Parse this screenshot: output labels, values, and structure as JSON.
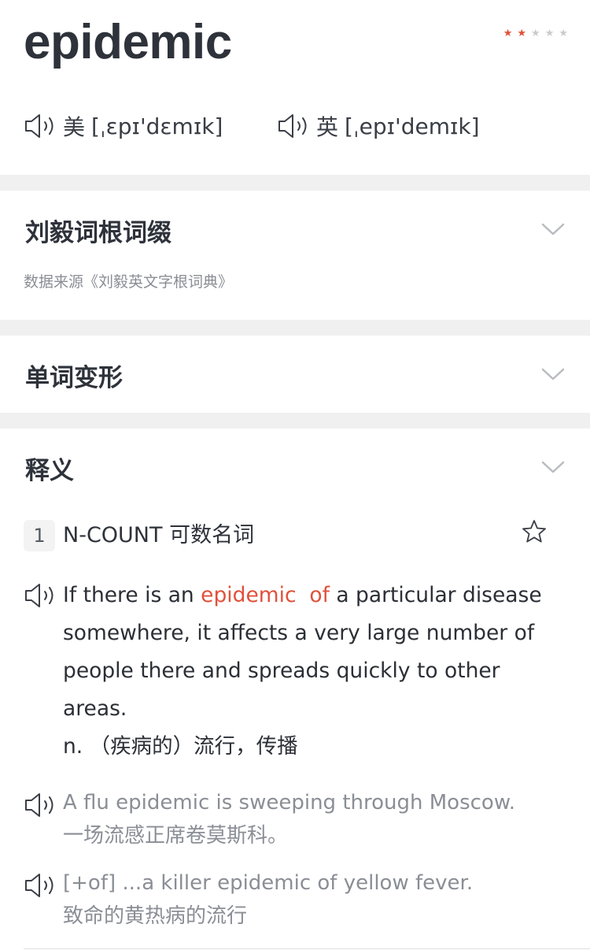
{
  "word": "epidemic",
  "rating": {
    "filled": 2,
    "total": 5,
    "filled_color": "#e0513b",
    "empty_color": "#c9cbcf"
  },
  "pronunciation": {
    "us": {
      "region": "美",
      "ipa": "[ˌɛpɪ'dɛmɪk]",
      "icon": "speaker-icon"
    },
    "uk": {
      "region": "英",
      "ipa": "[ˌepɪ'demɪk]",
      "icon": "speaker-icon"
    }
  },
  "sections": {
    "roots": {
      "title": "刘毅词根词缀",
      "source": "数据来源《刘毅英文字根词典》",
      "icon": "chevron-down-icon"
    },
    "forms": {
      "title": "单词变形",
      "icon": "chevron-down-icon"
    },
    "definitions": {
      "title": "释义",
      "icon": "chevron-down-icon"
    }
  },
  "definition": {
    "number": "1",
    "pos": "N-COUNT 可数名词",
    "text_before": "If there is an ",
    "highlight_word": "epidemic",
    "highlight_prep": "of",
    "text_after": " a particular disease somewhere, it affects a very large number of people there and spreads quickly to other areas.",
    "translation": "n. （疾病的）流行，传播",
    "accent_color": "#e0513b"
  },
  "examples": [
    {
      "en": "A flu epidemic is sweeping through Moscow.",
      "zh": "一场流感正席卷莫斯科。"
    },
    {
      "en": "[+of] ...a killer epidemic of yellow fever.",
      "zh": "致命的黄热病的流行"
    }
  ]
}
